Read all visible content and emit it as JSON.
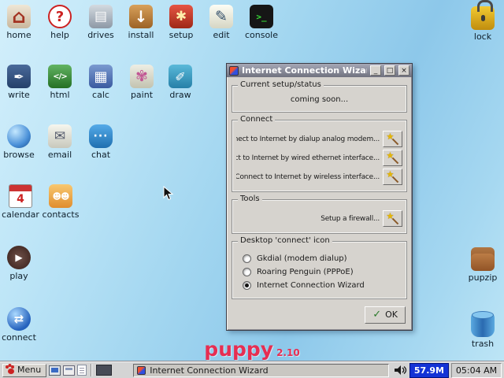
{
  "desktop": {
    "icons": [
      {
        "name": "home",
        "label": "home",
        "glyph": "⌂"
      },
      {
        "name": "help",
        "label": "help",
        "glyph": "?"
      },
      {
        "name": "drives",
        "label": "drives",
        "glyph": "▤"
      },
      {
        "name": "install",
        "label": "install",
        "glyph": "↓"
      },
      {
        "name": "setup",
        "label": "setup",
        "glyph": "✱"
      },
      {
        "name": "edit",
        "label": "edit",
        "glyph": "✎"
      },
      {
        "name": "console",
        "label": "console",
        "glyph": ">_"
      },
      {
        "name": "lock",
        "label": "lock",
        "glyph": ""
      },
      {
        "name": "write",
        "label": "write",
        "glyph": "✒"
      },
      {
        "name": "html",
        "label": "html",
        "glyph": "</>"
      },
      {
        "name": "calc",
        "label": "calc",
        "glyph": "▦"
      },
      {
        "name": "paint",
        "label": "paint",
        "glyph": "✾"
      },
      {
        "name": "draw",
        "label": "draw",
        "glyph": "✐"
      },
      {
        "name": "browse",
        "label": "browse",
        "glyph": ""
      },
      {
        "name": "email",
        "label": "email",
        "glyph": "✉"
      },
      {
        "name": "chat",
        "label": "chat",
        "glyph": "···"
      },
      {
        "name": "calendar",
        "label": "calendar",
        "glyph": "4"
      },
      {
        "name": "contacts",
        "label": "contacts",
        "glyph": "☻☻"
      },
      {
        "name": "play",
        "label": "play",
        "glyph": "▶"
      },
      {
        "name": "connect",
        "label": "connect",
        "glyph": "⇄"
      },
      {
        "name": "pupzip",
        "label": "pupzip",
        "glyph": ""
      },
      {
        "name": "trash",
        "label": "trash",
        "glyph": ""
      }
    ],
    "branding": {
      "name": "puppy",
      "version": "2.10",
      "color": "#e62e52"
    }
  },
  "window": {
    "title": "Internet Connection Wizard",
    "controls": {
      "minimize": "_",
      "maximize": "□",
      "close": "×"
    },
    "status_group": {
      "label": "Current setup/status",
      "text": "coming soon..."
    },
    "connect_group": {
      "label": "Connect",
      "items": [
        "Connect to Internet by dialup analog modem...",
        "Connect to Internet by wired ethernet interface...",
        "Connect to Internet by wireless interface..."
      ],
      "row_button_icon": "magic-wand-icon"
    },
    "tools_group": {
      "label": "Tools",
      "items": [
        "Setup a firewall..."
      ]
    },
    "icon_group": {
      "label": "Desktop 'connect' icon",
      "options": [
        {
          "label": "Gkdial (modem dialup)",
          "selected": false
        },
        {
          "label": "Roaring Penguin (PPPoE)",
          "selected": false
        },
        {
          "label": "Internet Connection Wizard",
          "selected": true
        }
      ]
    },
    "ok_label": "OK"
  },
  "taskbar": {
    "menu_label": "Menu",
    "tray_icons": [
      "display-icon",
      "windows-icon",
      "notes-icon",
      "pager"
    ],
    "task": {
      "title": "Internet Connection Wizard"
    },
    "volume_icon": "speaker-icon",
    "memory": "57.9M",
    "memory_color": "#1433d6",
    "clock": "05:04 AM"
  }
}
